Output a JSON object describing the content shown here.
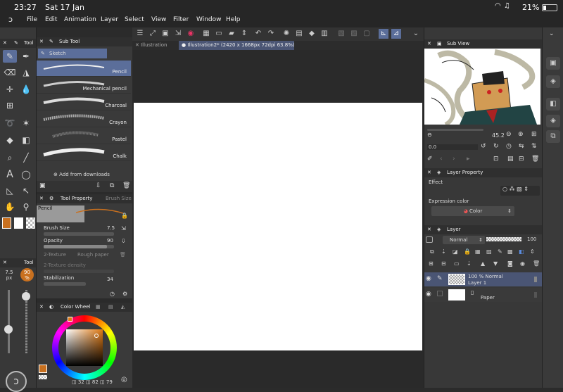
{
  "status": {
    "time": "23:27",
    "date": "Sat 17 Jan",
    "battery": "21%"
  },
  "menu": [
    "File",
    "Edit",
    "Animation",
    "Layer",
    "Select",
    "View",
    "Filter",
    "Window",
    "Help"
  ],
  "tabs": [
    {
      "label": "Illustration",
      "active": false
    },
    {
      "label": "Illustration2* (2420 x 1668px 72dpi 63.8%)",
      "active": true
    }
  ],
  "tool_panel": {
    "title": "Tool"
  },
  "tool_size": {
    "value": "7.5",
    "unit": "px",
    "opacity_value": "90",
    "opacity_unit": "%",
    "title": "Tool"
  },
  "subtool": {
    "title": "Sub Tool",
    "group": "Sketch",
    "brushes": [
      "Pencil",
      "Mechanical pencil",
      "Charcoal",
      "Crayon",
      "Pastel",
      "Chalk"
    ],
    "add_label": "Add from downloads"
  },
  "tool_property": {
    "title": "Tool Property",
    "tab2": "Brush Size",
    "preset": "Pencil",
    "brush_size_label": "Brush Size",
    "brush_size_value": "7.5",
    "opacity_label": "Opacity",
    "opacity_value": "90",
    "texture_label": "2-Texture",
    "texture_value": "Rough paper",
    "texture_density_label": "2-Texture density",
    "stabilization_label": "Stabilization",
    "stabilization_value": "34"
  },
  "color_wheel": {
    "title": "Color Wheel",
    "h": "32",
    "s": "82",
    "v": "79"
  },
  "sub_view": {
    "title": "Sub View",
    "zoom": "45.2",
    "angle": "0.0"
  },
  "layer_property": {
    "title": "Layer Property",
    "effect_label": "Effect",
    "expression_label": "Expression color",
    "expression_value": "Color"
  },
  "layer_panel": {
    "title": "Layer",
    "blend": "Normal",
    "opacity": "100",
    "layers": [
      {
        "name": "Layer 1",
        "info": "100 % Normal",
        "selected": true
      },
      {
        "name": "Paper",
        "info": "",
        "selected": false
      }
    ]
  },
  "colors": {
    "accent": "#5b6e9a",
    "main_color": "#c8701f",
    "bg": "#2b2b2b"
  }
}
